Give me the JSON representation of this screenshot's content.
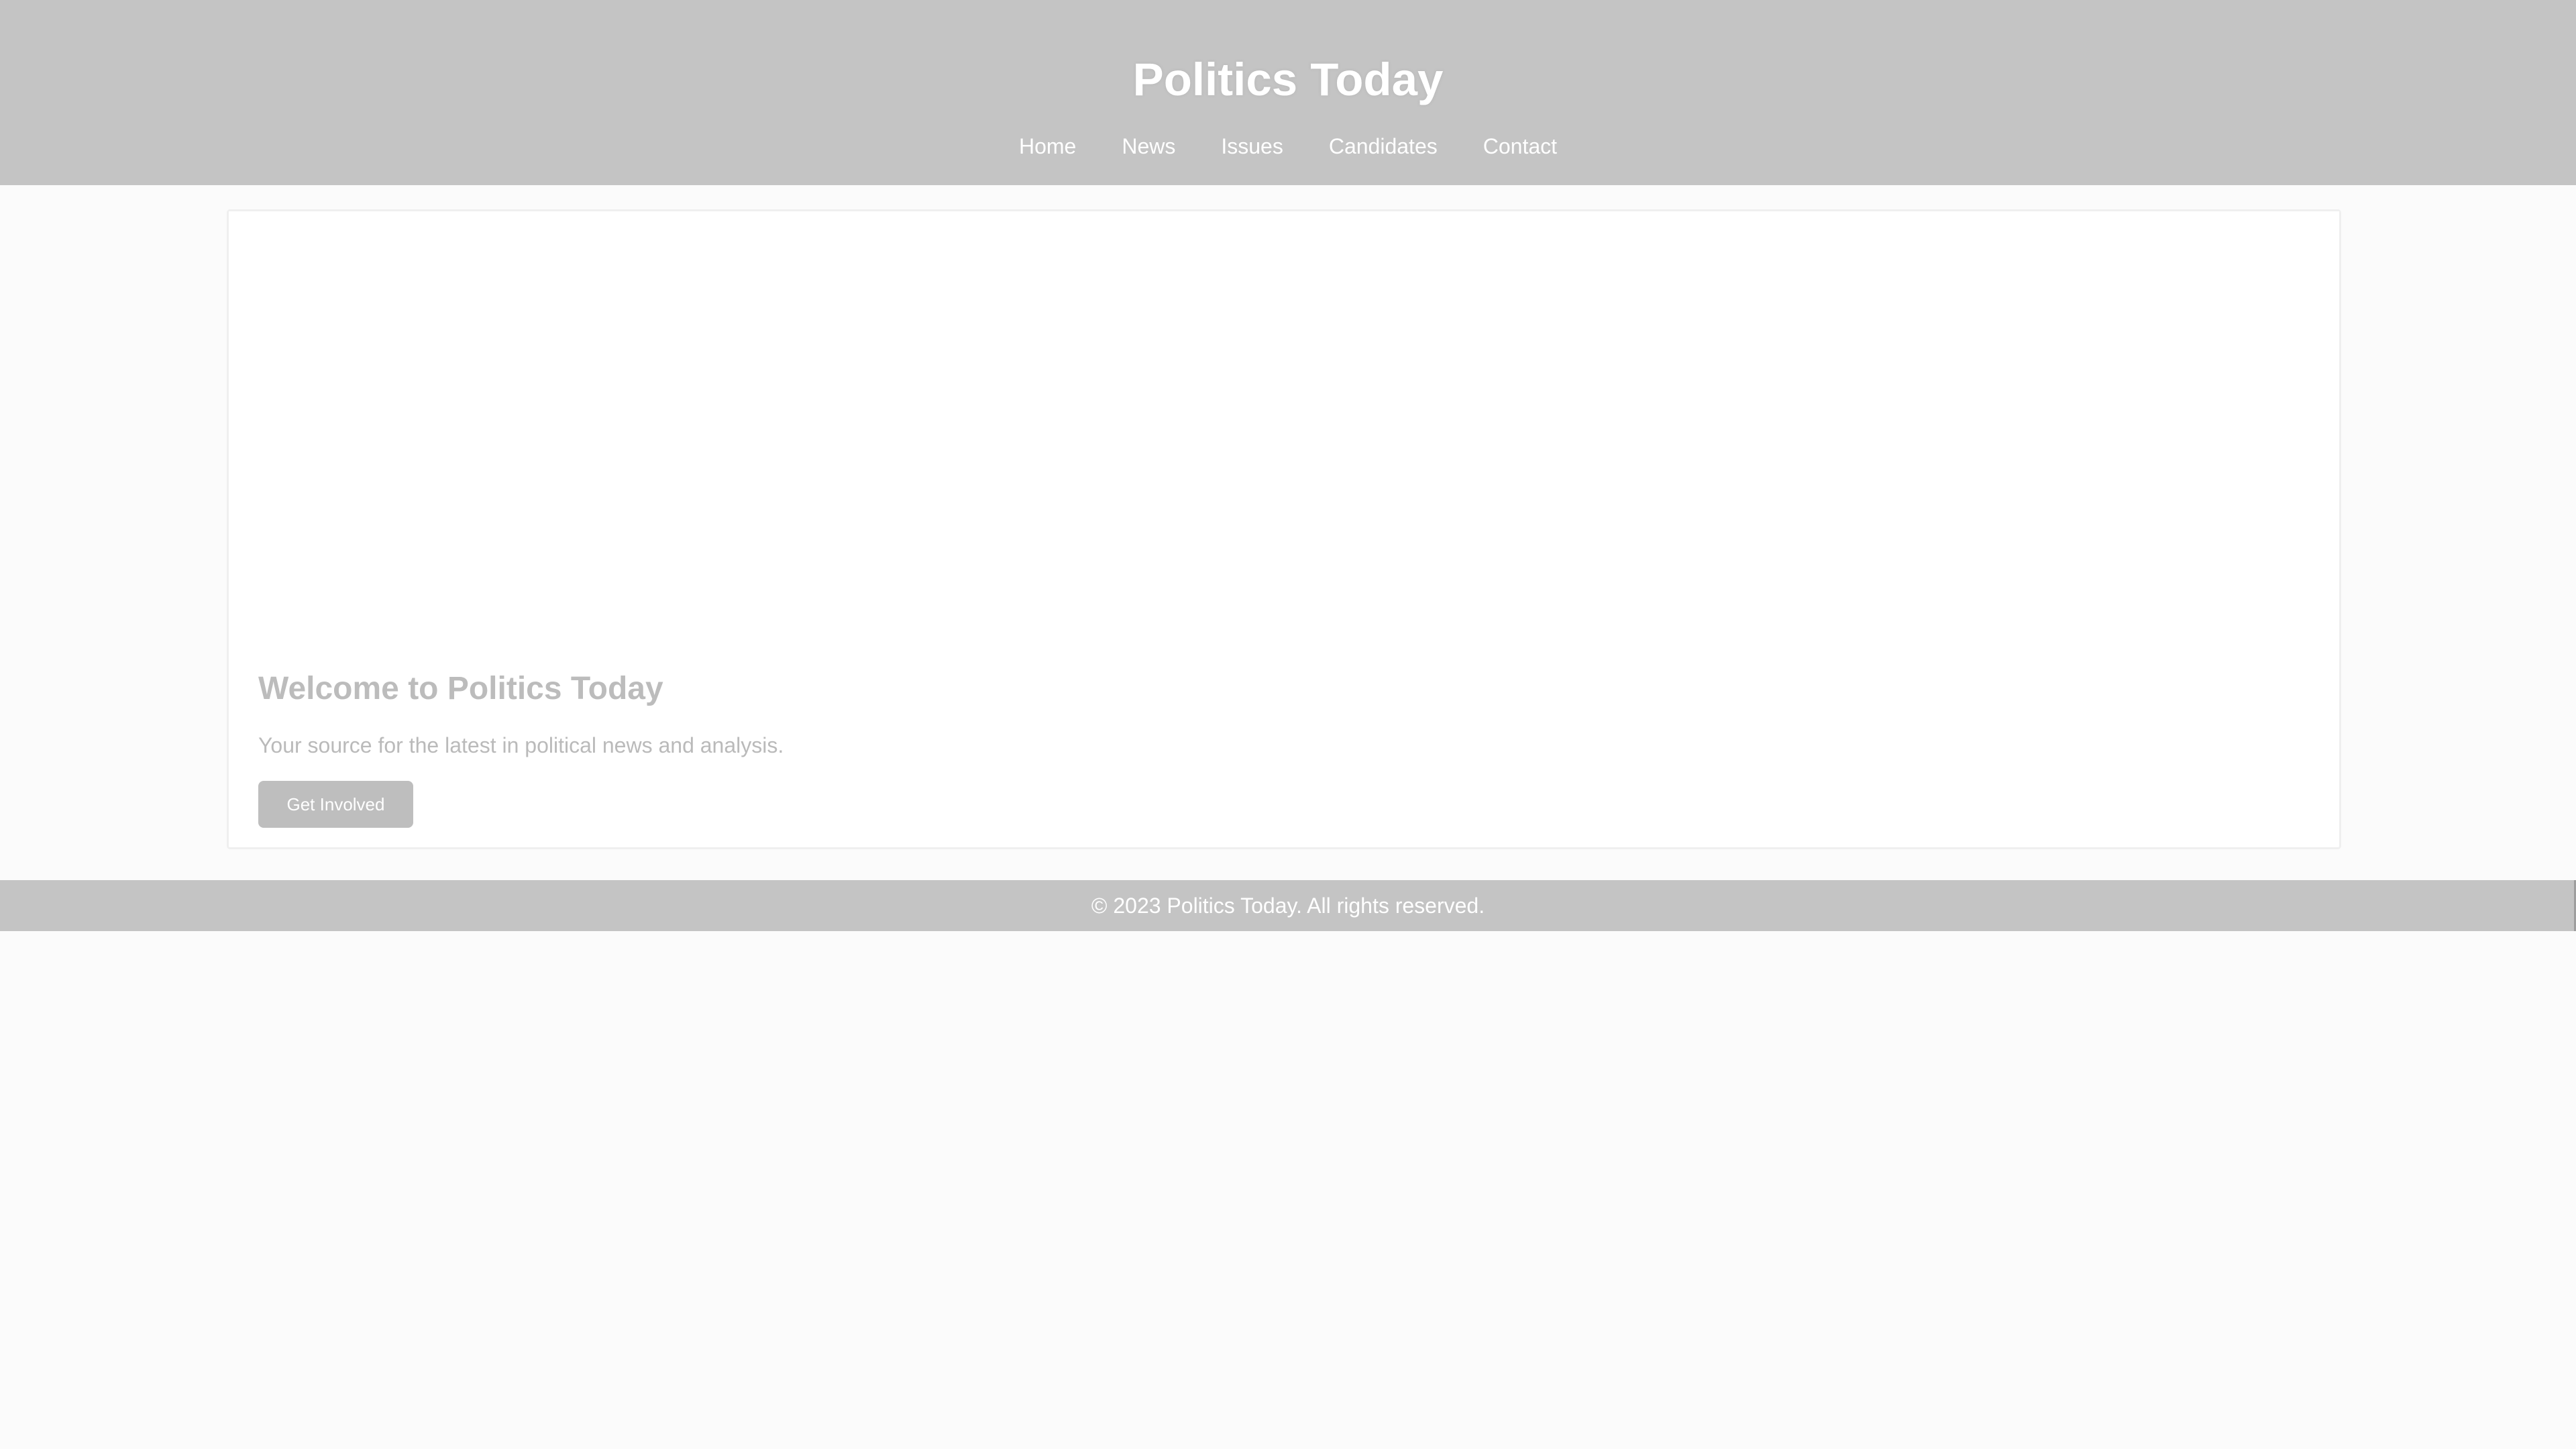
{
  "header": {
    "site_title": "Politics Today",
    "nav": [
      {
        "label": "Home"
      },
      {
        "label": "News"
      },
      {
        "label": "Issues"
      },
      {
        "label": "Candidates"
      },
      {
        "label": "Contact"
      }
    ]
  },
  "hero": {
    "title": "Welcome to Politics Today",
    "text": "Your source for the latest in political news and analysis.",
    "button_label": "Get Involved"
  },
  "footer": {
    "copyright": "© 2023 Politics Today. All rights reserved."
  },
  "colors": {
    "header_background": "#c4c4c4",
    "page_background": "#fbfbfb",
    "button_background": "#bebebe",
    "heading_text": "#bcbcbc"
  }
}
